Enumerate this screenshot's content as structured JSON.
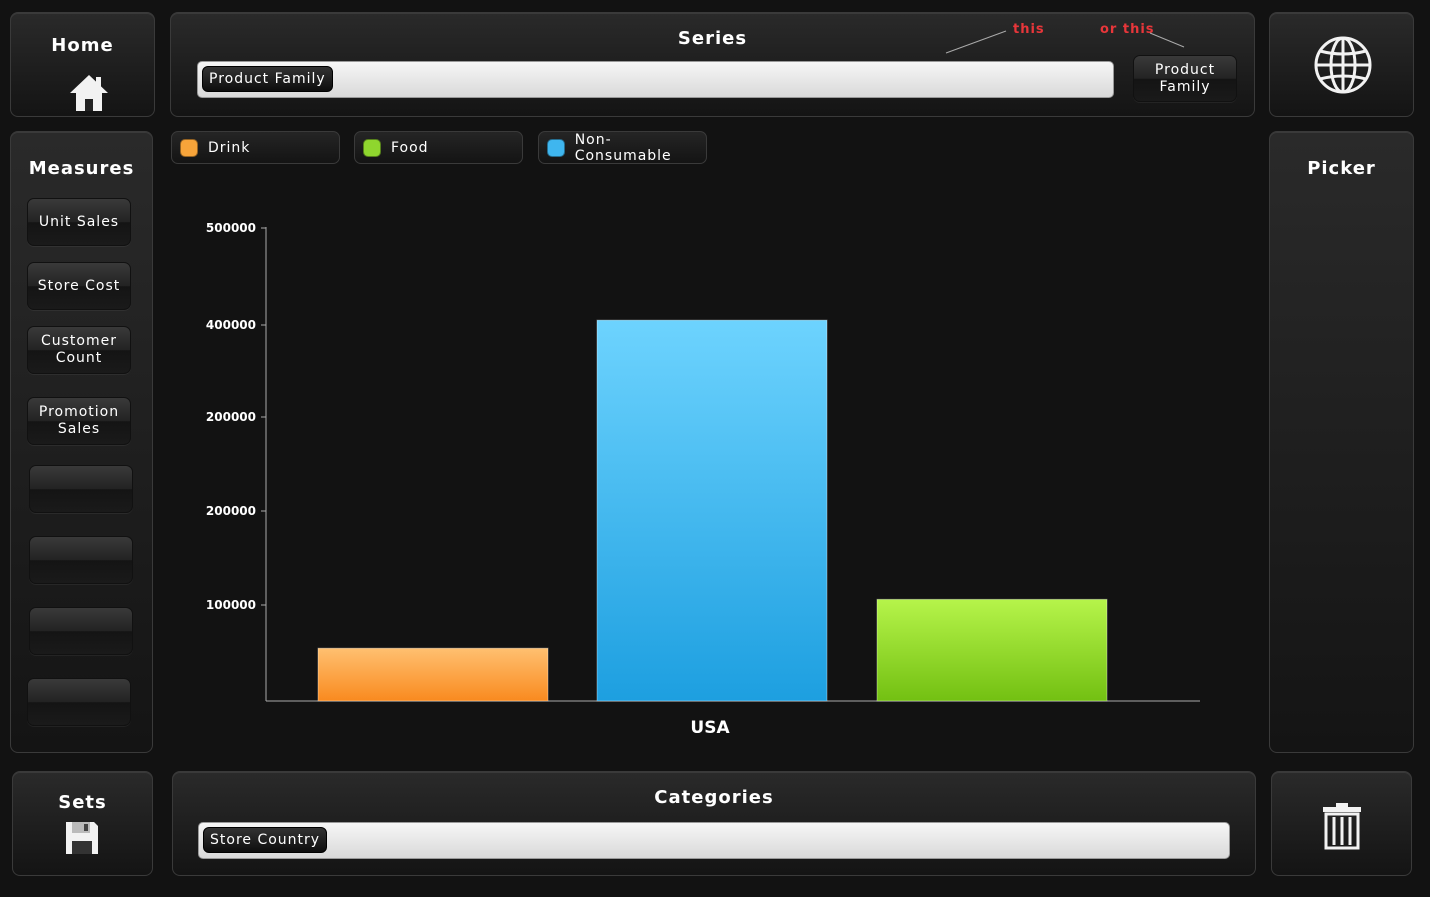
{
  "home": {
    "label": "Home",
    "icon": "home-icon"
  },
  "series": {
    "title": "Series",
    "selected_chip": "Product Family",
    "annotation_this": "this",
    "annotation_or_this": "or this",
    "option_button": "Product Family"
  },
  "globe": {
    "icon": "globe-icon"
  },
  "measures": {
    "title": "Measures",
    "items": [
      {
        "label": "Unit Sales"
      },
      {
        "label": "Store Cost"
      },
      {
        "label": "Customer Count"
      },
      {
        "label": "Promotion Sales"
      },
      {
        "label": ""
      },
      {
        "label": ""
      },
      {
        "label": ""
      },
      {
        "label": ""
      }
    ]
  },
  "legend": [
    {
      "label": "Drink",
      "color": "#f7a43a"
    },
    {
      "label": "Food",
      "color": "#8fd62e"
    },
    {
      "label": "Non-Consumable",
      "color": "#3fb6ef"
    }
  ],
  "picker": {
    "title": "Picker"
  },
  "sets": {
    "label": "Sets",
    "icon": "floppy-disk-icon"
  },
  "categories": {
    "title": "Categories",
    "selected_chip": "Store Country"
  },
  "trash": {
    "icon": "trash-icon"
  },
  "chart_data": {
    "type": "bar",
    "categories": [
      "USA"
    ],
    "y_tick_labels": [
      "500000",
      "400000",
      "200000",
      "200000",
      "100000"
    ],
    "series": [
      {
        "name": "Drink",
        "values": [
          55000
        ],
        "color": "#f7a43a"
      },
      {
        "name": "Non-Consumable",
        "values": [
          405000
        ],
        "color": "#3fb6ef"
      },
      {
        "name": "Food",
        "values": [
          106000
        ],
        "color": "#8fd62e"
      }
    ],
    "ylim": [
      0,
      500000
    ],
    "grid": false
  }
}
